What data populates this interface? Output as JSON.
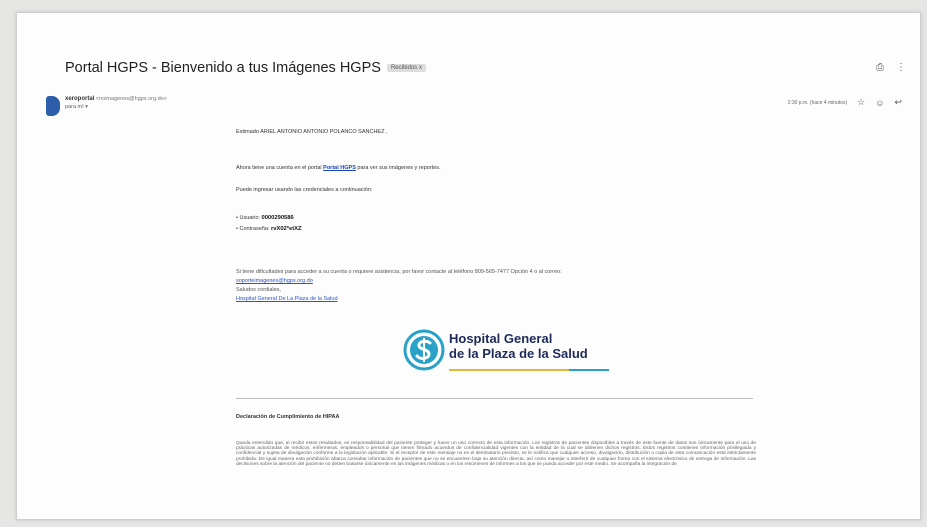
{
  "email": {
    "subject": "Portal HGPS - Bienvenido a tus Imágenes HGPS",
    "label_chip": "Recibidos x",
    "sender_name": "xeroportal",
    "sender_email": "<noimagenes@hgps.org.do>",
    "to_me": "para mí ▾",
    "date": "2:30 p.m. (hace 4 minutos)",
    "greeting": "Estimado ARIEL ANTONIO ANTONIO POLANCO SANCHEZ ,",
    "intro_before": "Ahora tiene una cuenta en el portal ",
    "portal_link": "Portal HGPS",
    "intro_after": " para ver sus imágenes y reportes.",
    "credentials_intro": "Puede ingresar usando las credenciales a continuación:",
    "user_label": "Usuario: ",
    "user_value": "0000290586",
    "pass_label": "Contraseña: ",
    "pass_value": "rvX02*etXZ",
    "help_text": "Si tiene dificultades para acceder a su cuenta o requiere asistencia, por favor contacte al teléfono 809-565-7477 Opción 4 o al correo:",
    "support_email": "soporteimagenes@hgps.org.do",
    "closing": "Saludos cordiales,",
    "hospital_link": "Hospital General De La Plaza de la Salud",
    "logo_line1": "Hospital General",
    "logo_line2a": "de la Plaza de la ",
    "logo_line2b": "Salud",
    "hipaa_title": "Declaración de Cumplimiento de HIPAA",
    "hipaa_text": "Queda entendido que, al recibir estos resultados, es responsabilidad del paciente proteger y hacer un uso correcto de esta información. Los registros de pacientes disponibles a través de este fuente de datos son únicamente para el uso de prácticas autorizadas de médicos, enfermeras, empleados o personal que tienen firmado acuerdos de confidencialidad vigentes con la entidad de la cual se obtienen dichos registros. Estos registros contienen información privilegiada y confidencial y sujeta de divulgación conforme a la legislación aplicable. Si el receptor de este mensaje no es el destinatario previsto, se le notifica que cualquier acceso, divulgación, distribución o copia de esta comunicación está estrictamente prohibida. De igual manera esta prohibición abarca consultar información de pacientes que no se encuentren bajo su atención directa, así como manejar o interferir de cualquier forma con el sistema electrónico de entrega de información. Las decisiones sobre la atención del paciente no deben basarse únicamente en las imágenes médicas o en los resúmenes de informes a los que se pueda acceder por este medio. Se acompaña la integración de"
  },
  "icons": {
    "print": "print-icon",
    "more": "more-vert-icon",
    "star": "star-icon",
    "emoji": "emoji-icon",
    "reply": "reply-icon"
  },
  "colors": {
    "link": "#2a55c9",
    "logo_navy": "#1e2a5a",
    "logo_teal": "#2aa2c7",
    "logo_yellow": "#e2b637"
  }
}
